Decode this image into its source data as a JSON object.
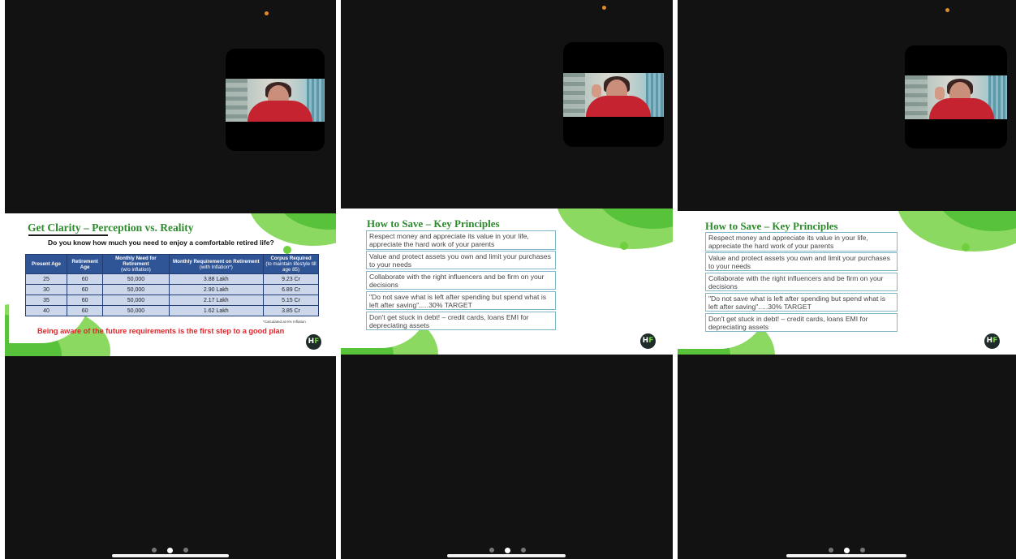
{
  "screens": [
    {
      "slide": {
        "title": "Get Clarity – Perception vs. Reality",
        "question": "Do you know how much you need to enjoy a comfortable retired life?",
        "table": {
          "headers": [
            {
              "main": "Present Age",
              "sub": ""
            },
            {
              "main": "Retirement Age",
              "sub": ""
            },
            {
              "main": "Monthly Need for Retirement",
              "sub": "(w/o inflation)"
            },
            {
              "main": "Monthly Requirement on Retirement",
              "sub": "(with Inflation*)"
            },
            {
              "main": "Corpus Required",
              "sub": "(to maintain lifestyle till age 85)"
            }
          ],
          "rows": [
            [
              "25",
              "60",
              "50,000",
              "3.88 Lakh",
              "9.23 Cr"
            ],
            [
              "30",
              "60",
              "50,000",
              "2.90 Lakh",
              "6.89 Cr"
            ],
            [
              "35",
              "60",
              "50,000",
              "2.17 Lakh",
              "5.15 Cr"
            ],
            [
              "40",
              "60",
              "50,000",
              "1.62 Lakh",
              "3.85 Cr"
            ]
          ]
        },
        "footnote": "*Calculated at 6% Inflation",
        "tagline": "Being aware of the future requirements is the first step to a good plan",
        "logo": {
          "left": "H",
          "right": "F"
        }
      },
      "pager": {
        "count": 3,
        "active": 1
      }
    },
    {
      "slide": {
        "title": "How to Save –  Key Principles",
        "principles": [
          "Respect money and appreciate its value in your life, appreciate the hard work of your parents",
          "Value and protect assets you own and limit your purchases to your needs",
          "Collaborate with the right influencers and be firm on your decisions",
          "\"Do not save what is left after spending but spend what is left after saving\".....30% TARGET",
          "Don't get stuck in debt! – credit cards, loans EMI for depreciating assets"
        ],
        "logo": {
          "left": "H",
          "right": "F"
        }
      },
      "pager": {
        "count": 3,
        "active": 1
      }
    },
    {
      "slide": {
        "title": "How to Save –  Key Principles",
        "principles": [
          "Respect money and appreciate its value in your life, appreciate the hard work of your parents",
          "Value and protect assets you own and limit your purchases to your needs",
          "Collaborate with the right influencers and be firm on your decisions",
          "\"Do not save what is left after spending but spend what is left after saving\".....30% TARGET",
          "Don't get stuck in debt! – credit cards, loans EMI for depreciating assets"
        ],
        "logo": {
          "left": "H",
          "right": "F"
        }
      },
      "pager": {
        "count": 3,
        "active": 1
      }
    }
  ],
  "colors": {
    "background": "#121212",
    "title_green": "#2d8a2d",
    "accent_green": "#57c23a",
    "table_header": "#2f5597",
    "table_cell": "#cdd7ec",
    "tagline_red": "#e0252b",
    "box_border": "#7fb7c9"
  },
  "icons": [
    "hf-logo-icon",
    "camera-indicator-icon",
    "video-participant-icon"
  ]
}
